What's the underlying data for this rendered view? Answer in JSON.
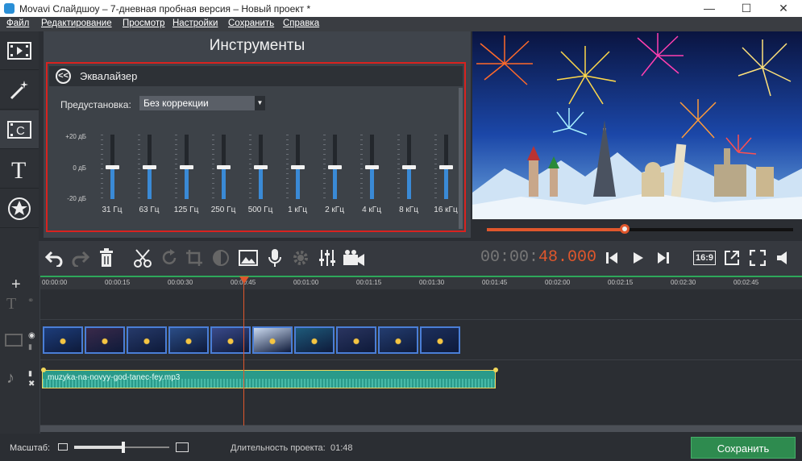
{
  "window": {
    "title": "Movavi Слайдшоу – 7-дневная пробная версия – Новый проект *"
  },
  "menu": [
    "Файл",
    "Редактирование",
    "Просмотр",
    "Настройки",
    "Сохранить",
    "Справка"
  ],
  "sidebar": [
    {
      "name": "media-icon"
    },
    {
      "name": "magic-wand-icon"
    },
    {
      "name": "transitions-icon"
    },
    {
      "name": "text-icon"
    },
    {
      "name": "stickers-icon"
    },
    {
      "name": "more-icon"
    }
  ],
  "tools": {
    "title": "Инструменты",
    "equalizer": {
      "label": "Эквалайзер",
      "preset_label": "Предустановка:",
      "preset_value": "Без коррекции",
      "db_top": "+20 дБ",
      "db_mid": "0 дБ",
      "db_bottom": "-20 дБ",
      "bands": [
        {
          "label": "31 Гц",
          "level": 0
        },
        {
          "label": "63 Гц",
          "level": 0
        },
        {
          "label": "125 Гц",
          "level": 0
        },
        {
          "label": "250 Гц",
          "level": 0
        },
        {
          "label": "500 Гц",
          "level": 0
        },
        {
          "label": "1 кГц",
          "level": 0
        },
        {
          "label": "2 кГц",
          "level": 0
        },
        {
          "label": "4 кГц",
          "level": 0
        },
        {
          "label": "8 кГц",
          "level": 0
        },
        {
          "label": "16 кГц",
          "level": 0
        }
      ]
    }
  },
  "player": {
    "timecode_dim": "00:00:",
    "timecode_hl": "48.000",
    "progress": 0.45,
    "aspect": "16:9"
  },
  "ruler": [
    "00:00:00",
    "00:00:15",
    "00:00:30",
    "00:00:45",
    "00:01:00",
    "00:01:15",
    "00:01:30",
    "00:01:45",
    "00:02:00",
    "00:02:15",
    "00:02:30",
    "00:02:45"
  ],
  "audio_clip": "muzyka-na-novyy-god-tanec-fey.mp3",
  "status": {
    "scale_label": "Масштаб:",
    "duration_label": "Длительность проекта:",
    "duration_value": "01:48",
    "save": "Сохранить"
  },
  "colors": {
    "accent": "#e0572c",
    "save": "#2e8b4f",
    "eq_fill": "#3a8ad6",
    "highlight_box": "#d9221f"
  }
}
